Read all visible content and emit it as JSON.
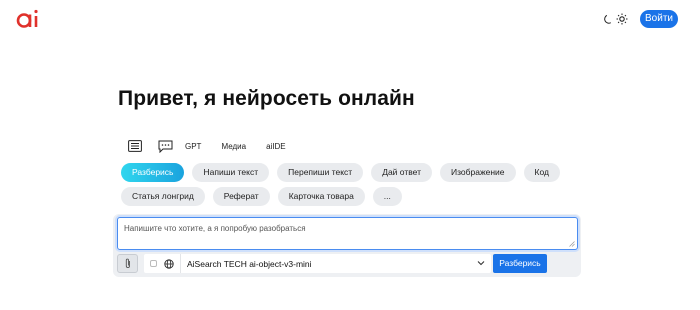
{
  "header": {
    "logo_text": "ai",
    "theme_icons": [
      "moon-icon",
      "sun-icon"
    ],
    "login_label": "Войти"
  },
  "hero": {
    "title": "Привет, я нейросеть онлайн"
  },
  "mode_tabs": [
    {
      "icon": "list-icon"
    },
    {
      "icon": "chat-icon"
    },
    {
      "label": "GPT"
    },
    {
      "label": "Медиа"
    },
    {
      "label": "aiIDE"
    }
  ],
  "chips": {
    "row1": [
      "Разберись",
      "Напиши текст",
      "Перепиши текст",
      "Дай ответ",
      "Изображение",
      "Код"
    ],
    "row2": [
      "Статья лонгрид",
      "Реферат",
      "Карточка товара",
      "..."
    ],
    "active": "Разберись"
  },
  "composer": {
    "placeholder": "Напишите что хотите, а я попробую разобраться",
    "model": "AiSearch TECH ai-object-v3-mini",
    "submit_label": "Разберись"
  },
  "colors": {
    "accent": "#1a73e8",
    "logo": "#e0312b",
    "chip_bg": "#e9ebee",
    "chip_active_start": "#30d6ee",
    "chip_active_end": "#1aa3de"
  }
}
